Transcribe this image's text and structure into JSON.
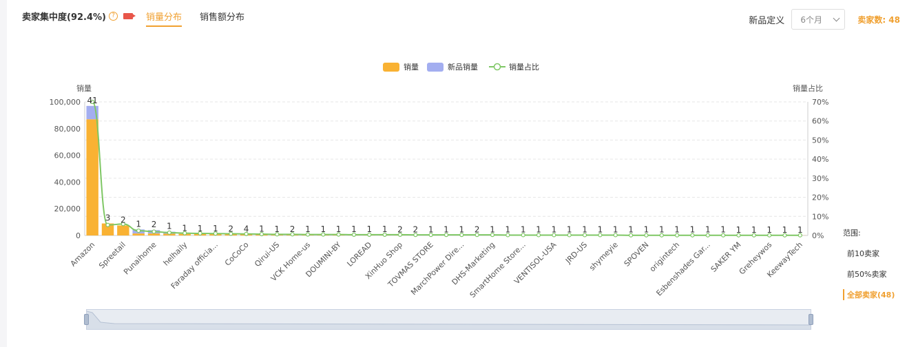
{
  "header": {
    "title": "卖家集中度(92.4%)",
    "help_glyph": "?",
    "tabs": [
      "销量分布",
      "销售额分布"
    ],
    "active_tab": 0,
    "new_def_label": "新品定义",
    "select_value": "6个月",
    "seller_count": "卖家数: 48"
  },
  "range": {
    "label": "范围:",
    "options": [
      "前10卖家",
      "前50%卖家",
      "全部卖家(48)"
    ],
    "active": 2
  },
  "colors": {
    "sales": "#f9b233",
    "new_sales": "#a3aef0",
    "ratio": "#7ec764",
    "accent": "#f0a030"
  },
  "chart_data": {
    "type": "bar",
    "legend": [
      "销量",
      "新品销量",
      "销量占比"
    ],
    "y_left_label": "销量",
    "y_right_label": "销量占比",
    "y_left_ticks": [
      "100,000",
      "80,000",
      "60,000",
      "40,000",
      "20,000",
      "0"
    ],
    "y_right_ticks": [
      "70%",
      "60%",
      "50%",
      "40%",
      "30%",
      "20%",
      "10%",
      "0%"
    ],
    "ylim": [
      0,
      100000
    ],
    "y2lim": [
      0,
      70
    ],
    "visible_x_labels": [
      "Amazon",
      "Spreetail",
      "Punaihome",
      "helhaily",
      "Faraday officia...",
      "CoCoCo",
      "Qirui-US",
      "VCK Home-us",
      "DOUMINI-BY",
      "LOREAD",
      "XinHuo Shop",
      "TOVMAS STORE",
      "MarchPower Dire...",
      "DHS-Marketing",
      "SmartHome Store...",
      "VENTISOL-USA",
      "JRD-US",
      "shymeyie",
      "SPOVEN",
      "origintech",
      "Esbenshades Gar...",
      "SAKER YM",
      "Greheywos",
      "KeewayTech"
    ],
    "bar_labels": [
      "41",
      "3",
      "2",
      "1",
      "2",
      "1",
      "1",
      "1",
      "1",
      "2",
      "4",
      "1",
      "1",
      "2",
      "1",
      "1",
      "1",
      "1",
      "1",
      "1",
      "2",
      "2",
      "1",
      "1",
      "1",
      "2",
      "1",
      "1",
      "1",
      "1",
      "1",
      "1",
      "1",
      "1",
      "1",
      "1",
      "1",
      "1",
      "1",
      "1",
      "1",
      "1",
      "1",
      "1",
      "1",
      "1",
      "1"
    ],
    "sales": [
      87000,
      9000,
      7500,
      1500,
      1500,
      1300,
      1200,
      1100,
      1000,
      900,
      800,
      700,
      600,
      600,
      550,
      500,
      480,
      450,
      420,
      400,
      380,
      360,
      340,
      320,
      300,
      290,
      280,
      270,
      260,
      250,
      240,
      230,
      220,
      210,
      200,
      190,
      180,
      170,
      160,
      150,
      140,
      130,
      120,
      110,
      100,
      90,
      80
    ],
    "new_sales": [
      10000,
      0,
      0,
      3000,
      2500,
      1500,
      0,
      0,
      0,
      0,
      0,
      0,
      0,
      0,
      0,
      0,
      0,
      0,
      0,
      0,
      0,
      0,
      0,
      0,
      0,
      0,
      0,
      0,
      0,
      0,
      0,
      0,
      0,
      0,
      0,
      0,
      0,
      0,
      0,
      0,
      0,
      0,
      0,
      0,
      0,
      0,
      0
    ],
    "ratio_pct": [
      70,
      5.5,
      6,
      2.5,
      2,
      1.5,
      1.2,
      1.1,
      1,
      0.9,
      0.8,
      0.7,
      0.6,
      0.6,
      0.5,
      0.5,
      0.5,
      0.4,
      0.4,
      0.4,
      0.4,
      0.3,
      0.3,
      0.3,
      0.3,
      0.3,
      0.3,
      0.2,
      0.2,
      0.2,
      0.2,
      0.2,
      0.2,
      0.2,
      0.2,
      0.1,
      0.1,
      0.1,
      0.1,
      0.1,
      0.1,
      0.1,
      0.1,
      0.1,
      0.1,
      0.1,
      0.1
    ]
  }
}
